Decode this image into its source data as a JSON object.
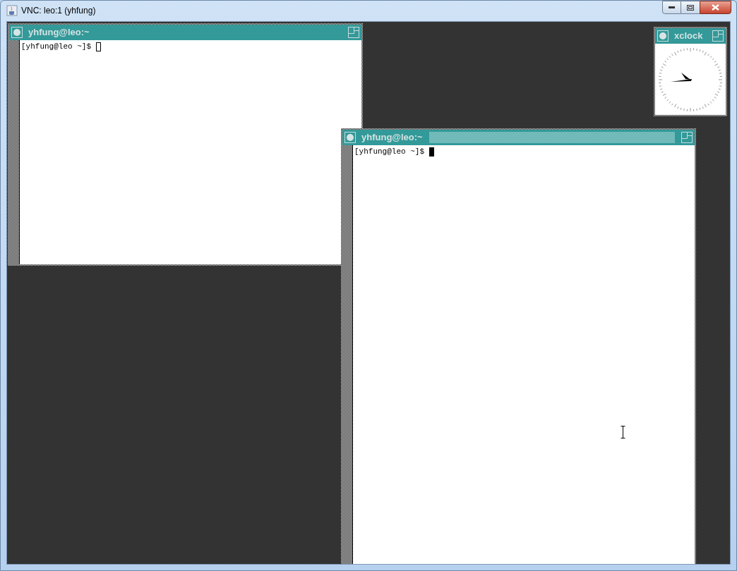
{
  "window": {
    "title": "VNC: leo:1 (yhfung)"
  },
  "desktop": {
    "windows": [
      {
        "kind": "terminal",
        "title": "yhfung@leo:~",
        "focused": false,
        "lines": [
          "[yhfung@leo ~]$"
        ]
      },
      {
        "kind": "terminal",
        "title": "yhfung@leo:~",
        "focused": true,
        "lines": [
          "[yhfung@leo ~]$"
        ]
      },
      {
        "kind": "clock",
        "title": "xclock"
      }
    ]
  }
}
